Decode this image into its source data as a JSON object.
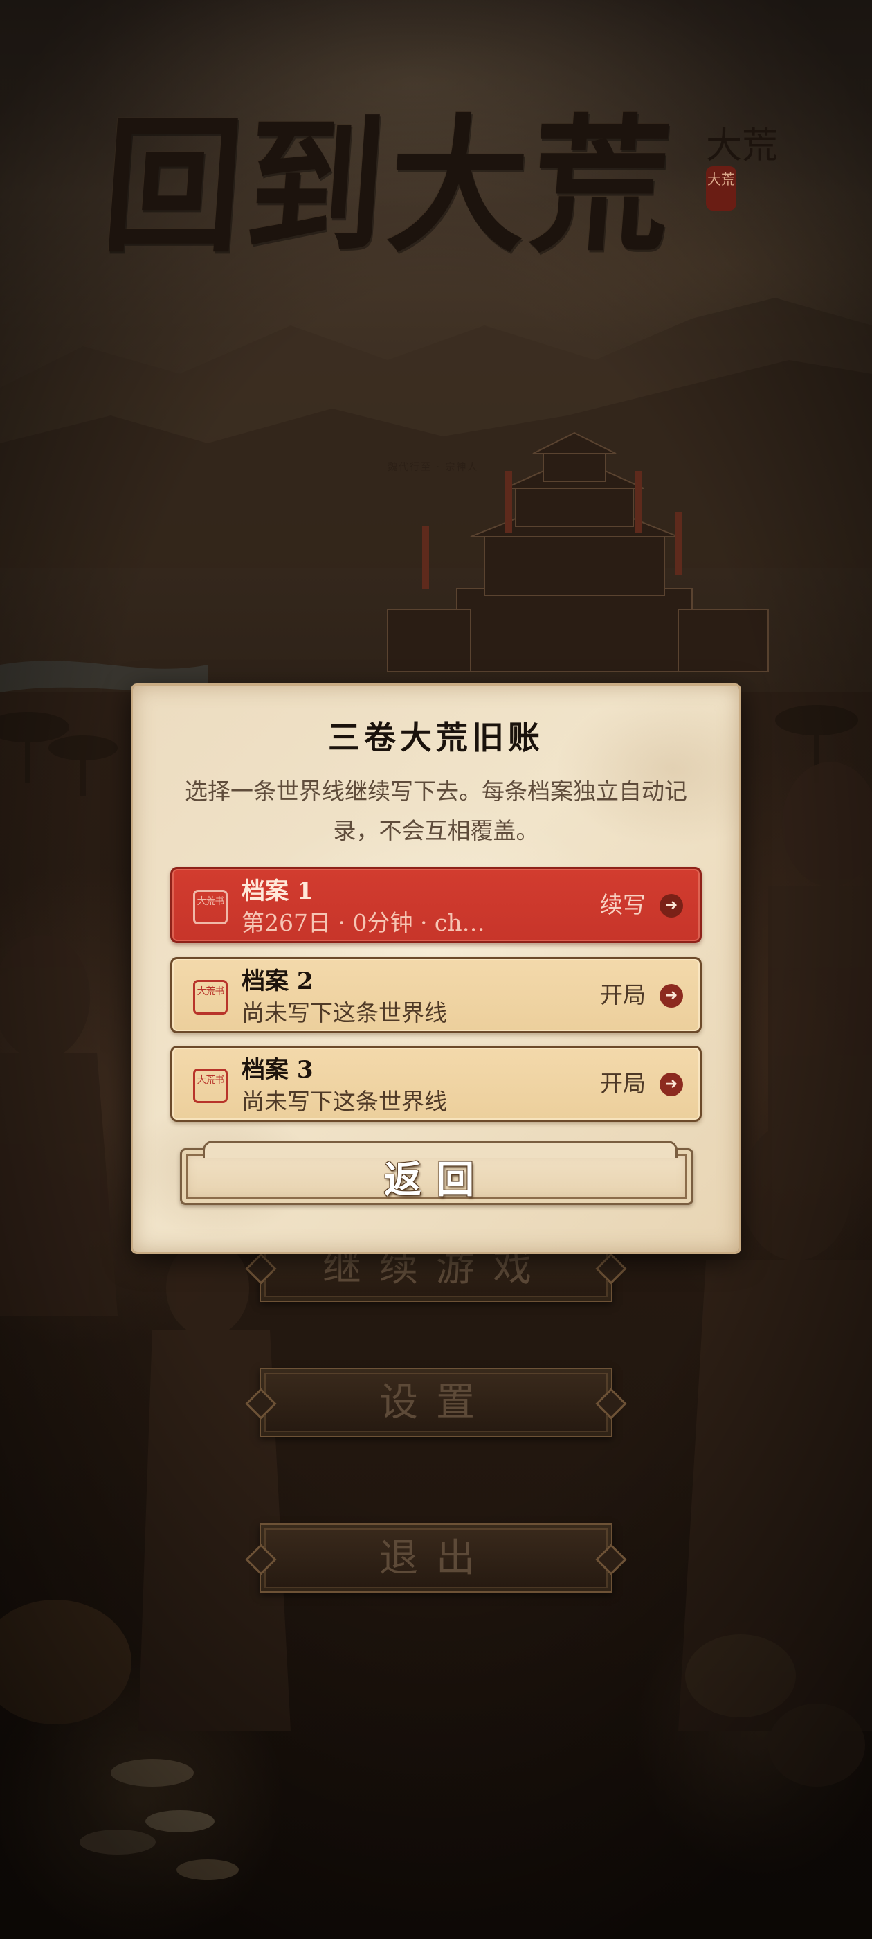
{
  "logo": {
    "title": "回到大荒",
    "small_text": "大荒",
    "seal_text": "大荒",
    "tagline": "魏代行至 · 宗神人"
  },
  "menu": {
    "continue_label": "继续游戏",
    "settings_label": "设置",
    "quit_label": "退出"
  },
  "dialog": {
    "title": "三卷大荒旧账",
    "description": "选择一条世界线继续写下去。每条档案独立自动记录，不会互相覆盖。",
    "slots": [
      {
        "name": "档案 1",
        "subtitle": "第267日 · 0分钟 · ch…",
        "action": "续写",
        "seal_text": "大荒书",
        "active": true
      },
      {
        "name": "档案 2",
        "subtitle": "尚未写下这条世界线",
        "action": "开局",
        "seal_text": "大荒书",
        "active": false
      },
      {
        "name": "档案 3",
        "subtitle": "尚未写下这条世界线",
        "action": "开局",
        "seal_text": "大荒书",
        "active": false
      }
    ],
    "back_label": "返回"
  },
  "colors": {
    "parchment": "#ecdcc0",
    "active_slot": "#d23c2f",
    "slot": "#f3d9ab",
    "ink": "#1a120c",
    "seal_red": "#b8342a"
  },
  "icons": {
    "slot_arrow": "arrow-right-circle-icon",
    "slot_seal": "seal-stamp-icon"
  }
}
